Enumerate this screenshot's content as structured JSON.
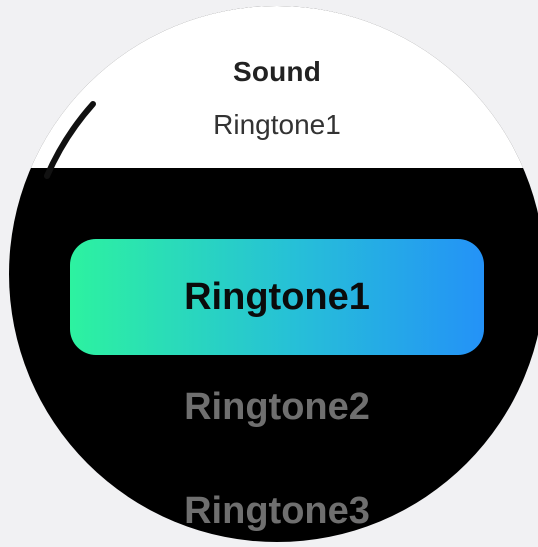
{
  "header": {
    "title": "Sound",
    "subtitle": "Ringtone1"
  },
  "ringtones": {
    "items": [
      {
        "label": "Ringtone1",
        "selected": true
      },
      {
        "label": "Ringtone2",
        "selected": false
      },
      {
        "label": "Ringtone3",
        "selected": false
      }
    ]
  },
  "colors": {
    "background": "#f1f1f3",
    "screen": "#000000",
    "header_bg": "#ffffff",
    "selected_gradient_start": "#2df2a0",
    "selected_gradient_end": "#2492f7",
    "unselected_text": "#6f6f6f"
  }
}
